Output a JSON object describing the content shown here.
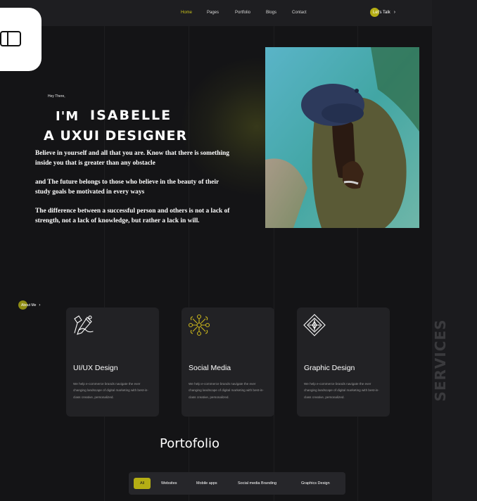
{
  "nav": {
    "links": [
      "Home",
      "Pages",
      "Portfolio",
      "Blogs",
      "Contact"
    ],
    "cta": "Let's Talk",
    "cta_chevron": "›"
  },
  "hero": {
    "greeting": "Hey There,",
    "line1_prefix": "I'M",
    "line1_name": "ISABELLE",
    "line2": "A UXUI DESIGNER",
    "paragraphs": [
      "Believe in yourself and all that you are. Know that there is something inside you that is greater than any obstacle",
      "and  The future belongs to those who believe in the beauty of their study goals be motivated in every ways",
      "The difference between a successful person and others is not a lack of strength, not a lack of knowledge, but rather a lack in will."
    ]
  },
  "about": {
    "label": "About Me",
    "chevron": "›"
  },
  "services": {
    "vertical_title": "SERVICES",
    "cards": [
      {
        "icon": "design-tools-icon",
        "title": "UI/UX Design",
        "desc": "We help e-commerce brands navigate the ever changing landscape of digital marketing with best-in-class creative, personalized."
      },
      {
        "icon": "social-network-icon",
        "title": "Social Media",
        "desc": "We help e-commerce brands navigate the ever changing landscape of digital marketing with best-in-class creative, personalized."
      },
      {
        "icon": "graphic-design-icon",
        "title": "Graphic Design",
        "desc": "We help e-commerce brands navigate the ever changing landscape of digital marketing with best-in-class creative, personalized."
      }
    ]
  },
  "portfolio": {
    "title": "Portofolio",
    "filters": [
      "All",
      "Websites",
      "Mobile apps",
      "Social media Branding",
      "Graphics Design"
    ],
    "active_filter": "All"
  },
  "colors": {
    "accent": "#c9c21b",
    "background": "#141416",
    "card": "#222225"
  }
}
